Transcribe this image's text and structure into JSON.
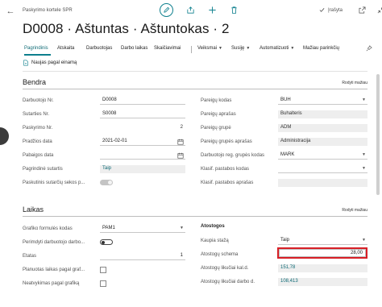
{
  "header": {
    "breadcrumb": "Paskyrimo kortele SPR",
    "saved_label": "Įrašyta",
    "title": "D0008 · Aštuntas · Aštuntokas · 2"
  },
  "actions": {
    "tabs": [
      "Pagrindinis",
      "Atskaita",
      "Darbuotojas",
      "Darbo laikas",
      "Skaičiavimai"
    ],
    "menus": [
      "Veiksmai",
      "Susiję",
      "Automatizuoti",
      "Mažiau parinkčių"
    ],
    "new_button": "Naujas pagal einamą"
  },
  "bendra": {
    "title": "Bendra",
    "show_less": "Rodyti mažiau",
    "left": {
      "darbuotojo_nr": {
        "label": "Darbuotojo Nr.",
        "value": "D0008"
      },
      "sutarties_nr": {
        "label": "Sutarties Nr.",
        "value": "S0008"
      },
      "paskyrimo_nr": {
        "label": "Paskyrimo Nr.",
        "value": "2"
      },
      "pradzios_data": {
        "label": "Pradžios data",
        "value": "2021-02-01"
      },
      "pabaigos_data": {
        "label": "Pabaigos data",
        "value": ""
      },
      "pagrindine_sutartis": {
        "label": "Pagrindinė sutartis",
        "value": "Taip"
      },
      "paskutinis_sutarties": {
        "label": "Paskutinis sutarčių sekos p...",
        "value": ""
      }
    },
    "right": {
      "pareigu_kodas": {
        "label": "Pareigų kodas",
        "value": "BUH"
      },
      "pareigu_aprasas": {
        "label": "Pareigų aprašas",
        "value": "Buhalteris"
      },
      "pareigu_grupe": {
        "label": "Pareigų grupė",
        "value": "ADM"
      },
      "pareigu_grupes_aprasas": {
        "label": "Pareigų grupės aprašas",
        "value": "Administracija"
      },
      "darbuotojo_reg_grupes": {
        "label": "Darbuotojo reg. grupės kodas",
        "value": "MARK"
      },
      "klasif_pastabos_kodas": {
        "label": "Klasif. pastabos kodas",
        "value": ""
      },
      "klasif_pastabos_aprasas": {
        "label": "Klasif. pastabos aprašas",
        "value": ""
      }
    }
  },
  "laikas": {
    "title": "Laikas",
    "show_less": "Rodyti mažiau",
    "left": {
      "grafiko_formules_kodas": {
        "label": "Grafiko formulės kodas",
        "value": "PAM1"
      },
      "perimdyti": {
        "label": "Perimdyti darbuotojo darbo...",
        "value": ""
      },
      "etatas": {
        "label": "Etatas",
        "value": "1"
      },
      "planuotas_laikas": {
        "label": "Planuotas laikas pagal graf...",
        "value": ""
      },
      "neatvykimas": {
        "label": "Neatvykimas pagal grafiką",
        "value": ""
      }
    },
    "atostogos": {
      "heading": "Atostogos",
      "kaupia_staza": {
        "label": "Kaupia stažą",
        "value": "Taip"
      },
      "atostogu_schema": {
        "label": "Atostogų schema",
        "value": "28,00"
      },
      "likuciai_kal_d": {
        "label": "Atostogų likučiai kal.d.",
        "value": "151,78"
      },
      "likuciai_darbo_d": {
        "label": "Atostogų likučiai darbo d.",
        "value": "108,413"
      }
    }
  },
  "colors": {
    "accent": "#0d7f8d",
    "highlight": "#d81f26"
  }
}
